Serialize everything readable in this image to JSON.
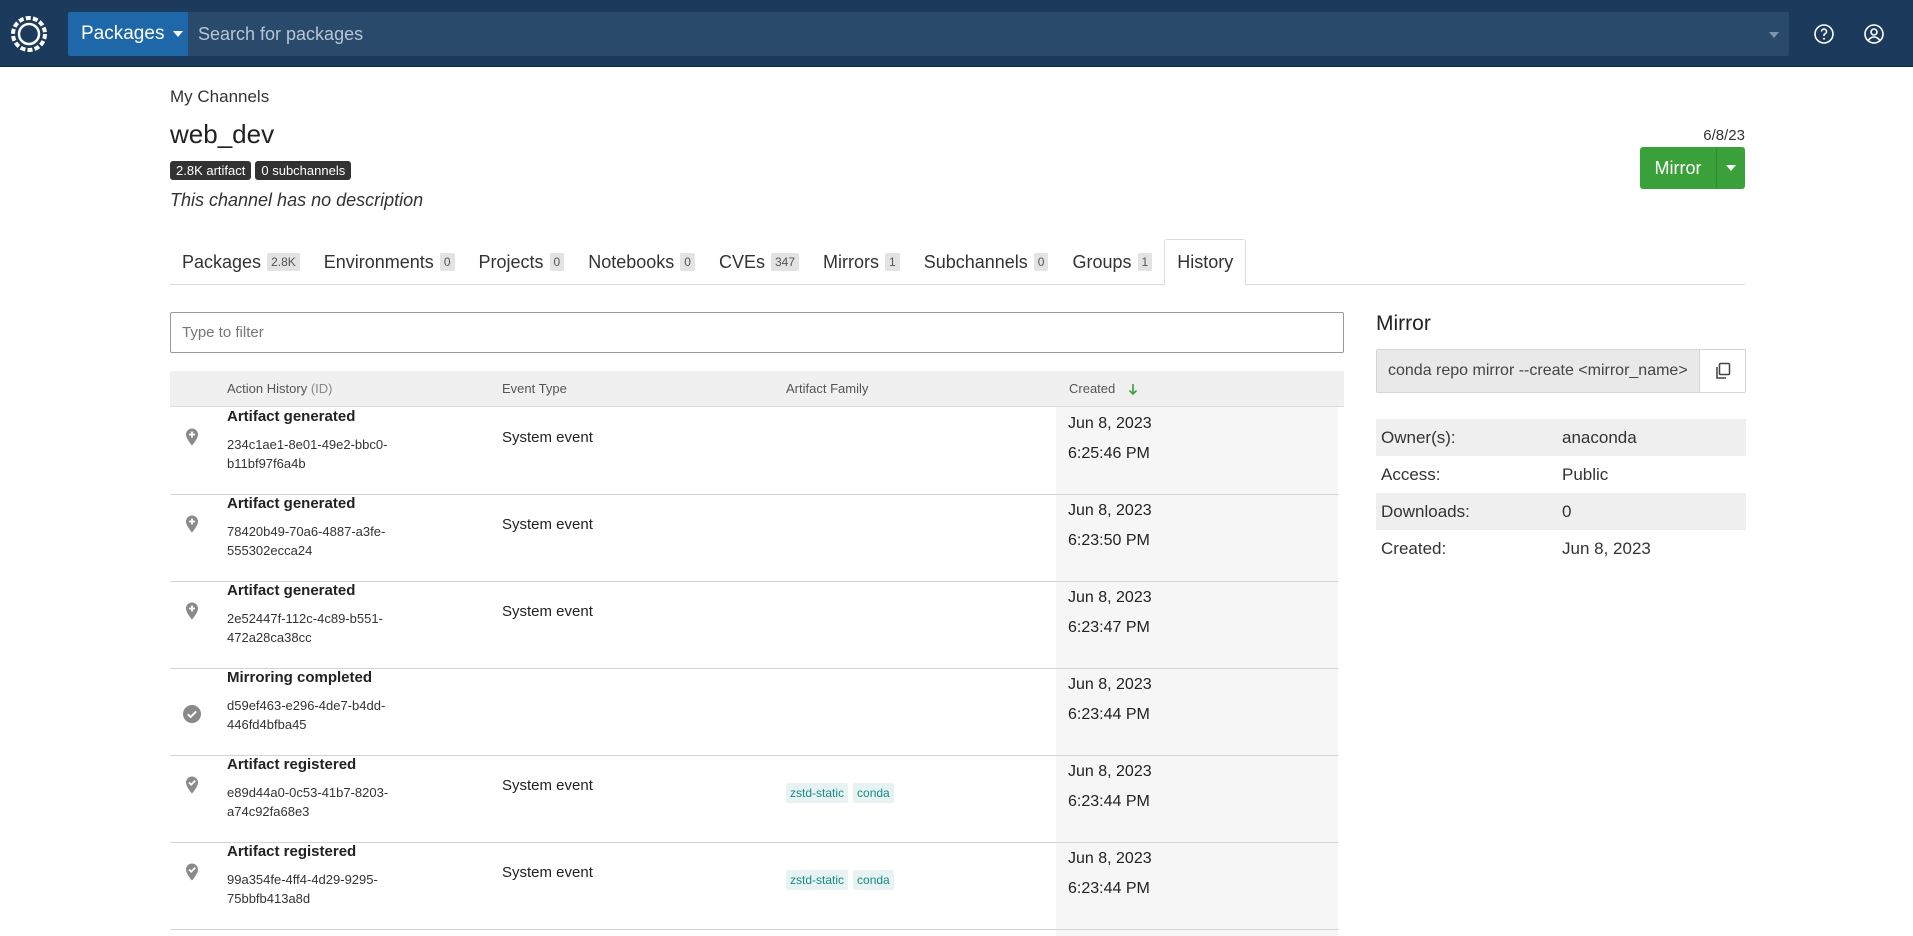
{
  "topbar": {
    "packages_label": "Packages",
    "search_placeholder": "Search for packages"
  },
  "header": {
    "breadcrumb": "My Channels",
    "channel_name": "web_dev",
    "badges": [
      "2.8K artifact",
      "0 subchannels"
    ],
    "description": "This channel has no description",
    "date": "6/8/23",
    "mirror_label": "Mirror"
  },
  "tabs": [
    {
      "label": "Packages",
      "count": "2.8K"
    },
    {
      "label": "Environments",
      "count": "0"
    },
    {
      "label": "Projects",
      "count": "0"
    },
    {
      "label": "Notebooks",
      "count": "0"
    },
    {
      "label": "CVEs",
      "count": "347"
    },
    {
      "label": "Mirrors",
      "count": "1"
    },
    {
      "label": "Subchannels",
      "count": "0"
    },
    {
      "label": "Groups",
      "count": "1"
    },
    {
      "label": "History",
      "count": ""
    }
  ],
  "filter": {
    "placeholder": "Type to filter"
  },
  "table": {
    "headers": {
      "action_history": "Action History",
      "action_history_suffix": "(ID)",
      "event_type": "Event Type",
      "artifact_family": "Artifact Family",
      "created": "Created"
    },
    "rows": [
      {
        "icon": "pin-plus-icon",
        "title": "Artifact generated",
        "id_line1": "234c1ae1-8e01-49e2-bbc0-",
        "id_line2": "b11bf97f6a4b",
        "event": "System event",
        "tags": [],
        "date": "Jun 8, 2023",
        "time": "6:25:46 PM"
      },
      {
        "icon": "pin-plus-icon",
        "title": "Artifact generated",
        "id_line1": "78420b49-70a6-4887-a3fe-",
        "id_line2": "555302ecca24",
        "event": "System event",
        "tags": [],
        "date": "Jun 8, 2023",
        "time": "6:23:50 PM"
      },
      {
        "icon": "pin-plus-icon",
        "title": "Artifact generated",
        "id_line1": "2e52447f-112c-4c89-b551-",
        "id_line2": "472a28ca38cc",
        "event": "System event",
        "tags": [],
        "date": "Jun 8, 2023",
        "time": "6:23:47 PM"
      },
      {
        "icon": "check-circle-icon",
        "title": "Mirroring completed",
        "id_line1": "d59ef463-e296-4de7-b4dd-",
        "id_line2": "446fd4bfba45",
        "event": "",
        "tags": [],
        "date": "Jun 8, 2023",
        "time": "6:23:44 PM"
      },
      {
        "icon": "pin-check-icon",
        "title": "Artifact registered",
        "id_line1": "e89d44a0-0c53-41b7-8203-",
        "id_line2": "a74c92fa68e3",
        "event": "System event",
        "tags": [
          "zstd-static",
          "conda"
        ],
        "date": "Jun 8, 2023",
        "time": "6:23:44 PM"
      },
      {
        "icon": "pin-check-icon",
        "title": "Artifact registered",
        "id_line1": "99a354fe-4ff4-4d29-9295-",
        "id_line2": "75bbfb413a8d",
        "event": "System event",
        "tags": [
          "zstd-static",
          "conda"
        ],
        "date": "Jun 8, 2023",
        "time": "6:23:44 PM"
      }
    ]
  },
  "side": {
    "title": "Mirror",
    "command": "conda repo mirror --create <mirror_name>",
    "info": [
      {
        "key": "Owner(s):",
        "value": "anaconda"
      },
      {
        "key": "Access:",
        "value": "Public"
      },
      {
        "key": "Downloads:",
        "value": "0"
      },
      {
        "key": "Created:",
        "value": "Jun 8, 2023"
      }
    ]
  },
  "colors": {
    "topbar": "#1b3a5c",
    "primary_button": "#1e67a8",
    "mirror_button": "#3aa13a",
    "tag_text": "#1a8a84"
  }
}
